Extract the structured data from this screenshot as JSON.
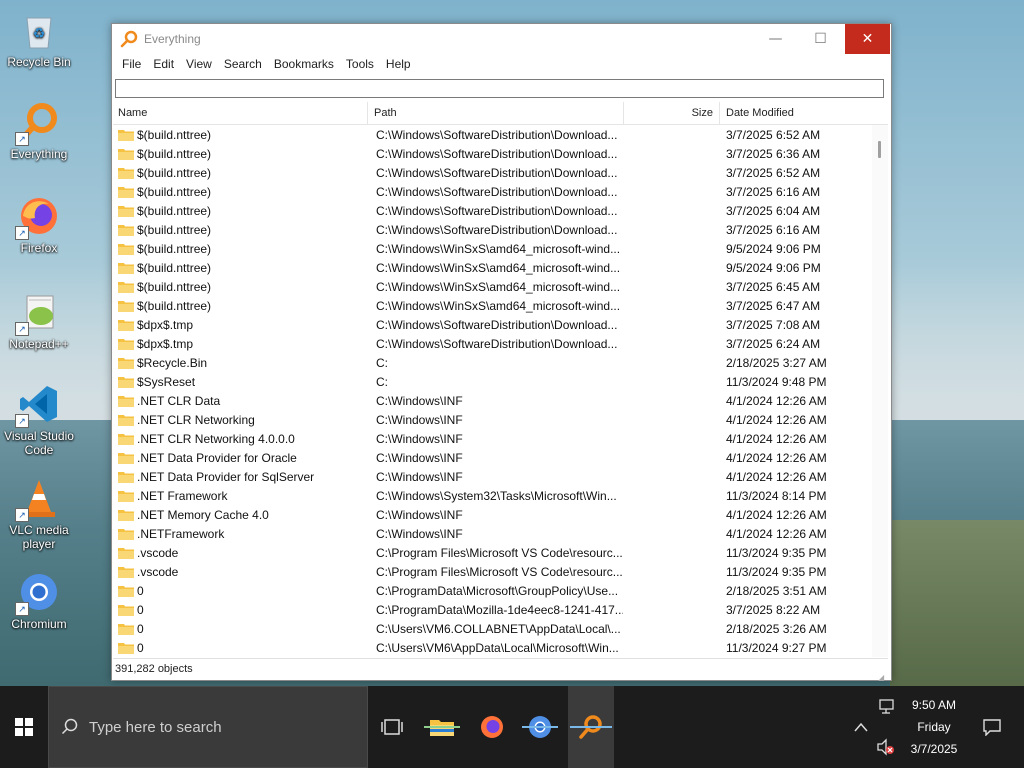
{
  "desktop": {
    "icons": [
      {
        "label": "Recycle Bin"
      },
      {
        "label": "Everything"
      },
      {
        "label": "Firefox"
      },
      {
        "label": "Notepad++"
      },
      {
        "label": "Visual Studio Code"
      },
      {
        "label": "VLC media player"
      },
      {
        "label": "Chromium"
      }
    ]
  },
  "window": {
    "title": "Everything",
    "controls": {
      "minimize": "—",
      "maximize": "☐",
      "close": "✕"
    },
    "menu": [
      "File",
      "Edit",
      "View",
      "Search",
      "Bookmarks",
      "Tools",
      "Help"
    ],
    "search": {
      "value": "",
      "placeholder": ""
    },
    "columns": {
      "name": "Name",
      "path": "Path",
      "size": "Size",
      "date": "Date Modified"
    },
    "rows": [
      {
        "name": "$(build.nttree)",
        "path": "C:\\Windows\\SoftwareDistribution\\Download...",
        "size": "",
        "date": "3/7/2025 6:52 AM"
      },
      {
        "name": "$(build.nttree)",
        "path": "C:\\Windows\\SoftwareDistribution\\Download...",
        "size": "",
        "date": "3/7/2025 6:36 AM"
      },
      {
        "name": "$(build.nttree)",
        "path": "C:\\Windows\\SoftwareDistribution\\Download...",
        "size": "",
        "date": "3/7/2025 6:52 AM"
      },
      {
        "name": "$(build.nttree)",
        "path": "C:\\Windows\\SoftwareDistribution\\Download...",
        "size": "",
        "date": "3/7/2025 6:16 AM"
      },
      {
        "name": "$(build.nttree)",
        "path": "C:\\Windows\\SoftwareDistribution\\Download...",
        "size": "",
        "date": "3/7/2025 6:04 AM"
      },
      {
        "name": "$(build.nttree)",
        "path": "C:\\Windows\\SoftwareDistribution\\Download...",
        "size": "",
        "date": "3/7/2025 6:16 AM"
      },
      {
        "name": "$(build.nttree)",
        "path": "C:\\Windows\\WinSxS\\amd64_microsoft-wind...",
        "size": "",
        "date": "9/5/2024 9:06 PM"
      },
      {
        "name": "$(build.nttree)",
        "path": "C:\\Windows\\WinSxS\\amd64_microsoft-wind...",
        "size": "",
        "date": "9/5/2024 9:06 PM"
      },
      {
        "name": "$(build.nttree)",
        "path": "C:\\Windows\\WinSxS\\amd64_microsoft-wind...",
        "size": "",
        "date": "3/7/2025 6:45 AM"
      },
      {
        "name": "$(build.nttree)",
        "path": "C:\\Windows\\WinSxS\\amd64_microsoft-wind...",
        "size": "",
        "date": "3/7/2025 6:47 AM"
      },
      {
        "name": "$dpx$.tmp",
        "path": "C:\\Windows\\SoftwareDistribution\\Download...",
        "size": "",
        "date": "3/7/2025 7:08 AM"
      },
      {
        "name": "$dpx$.tmp",
        "path": "C:\\Windows\\SoftwareDistribution\\Download...",
        "size": "",
        "date": "3/7/2025 6:24 AM"
      },
      {
        "name": "$Recycle.Bin",
        "path": "C:",
        "size": "",
        "date": "2/18/2025 3:27 AM"
      },
      {
        "name": "$SysReset",
        "path": "C:",
        "size": "",
        "date": "11/3/2024 9:48 PM"
      },
      {
        "name": ".NET CLR Data",
        "path": "C:\\Windows\\INF",
        "size": "",
        "date": "4/1/2024 12:26 AM"
      },
      {
        "name": ".NET CLR Networking",
        "path": "C:\\Windows\\INF",
        "size": "",
        "date": "4/1/2024 12:26 AM"
      },
      {
        "name": ".NET CLR Networking 4.0.0.0",
        "path": "C:\\Windows\\INF",
        "size": "",
        "date": "4/1/2024 12:26 AM"
      },
      {
        "name": ".NET Data Provider for Oracle",
        "path": "C:\\Windows\\INF",
        "size": "",
        "date": "4/1/2024 12:26 AM"
      },
      {
        "name": ".NET Data Provider for SqlServer",
        "path": "C:\\Windows\\INF",
        "size": "",
        "date": "4/1/2024 12:26 AM"
      },
      {
        "name": ".NET Framework",
        "path": "C:\\Windows\\System32\\Tasks\\Microsoft\\Win...",
        "size": "",
        "date": "11/3/2024 8:14 PM"
      },
      {
        "name": ".NET Memory Cache 4.0",
        "path": "C:\\Windows\\INF",
        "size": "",
        "date": "4/1/2024 12:26 AM"
      },
      {
        "name": ".NETFramework",
        "path": "C:\\Windows\\INF",
        "size": "",
        "date": "4/1/2024 12:26 AM"
      },
      {
        "name": ".vscode",
        "path": "C:\\Program Files\\Microsoft VS Code\\resourc...",
        "size": "",
        "date": "11/3/2024 9:35 PM"
      },
      {
        "name": ".vscode",
        "path": "C:\\Program Files\\Microsoft VS Code\\resourc...",
        "size": "",
        "date": "11/3/2024 9:35 PM"
      },
      {
        "name": "0",
        "path": "C:\\ProgramData\\Microsoft\\GroupPolicy\\Use...",
        "size": "",
        "date": "2/18/2025 3:51 AM"
      },
      {
        "name": "0",
        "path": "C:\\ProgramData\\Mozilla-1de4eec8-1241-417...",
        "size": "",
        "date": "3/7/2025 8:22 AM"
      },
      {
        "name": "0",
        "path": "C:\\Users\\VM6.COLLABNET\\AppData\\Local\\...",
        "size": "",
        "date": "2/18/2025 3:26 AM"
      },
      {
        "name": "0",
        "path": "C:\\Users\\VM6\\AppData\\Local\\Microsoft\\Win...",
        "size": "",
        "date": "11/3/2024 9:27 PM"
      }
    ],
    "status": "391,282 objects"
  },
  "taskbar": {
    "search_placeholder": "Type here to search",
    "clock": {
      "time": "9:50 AM",
      "day": "Friday",
      "date": "3/7/2025"
    }
  },
  "colors": {
    "close": "#c42b1c",
    "folder": "#f5c242",
    "accent": "#7ab8e8"
  }
}
